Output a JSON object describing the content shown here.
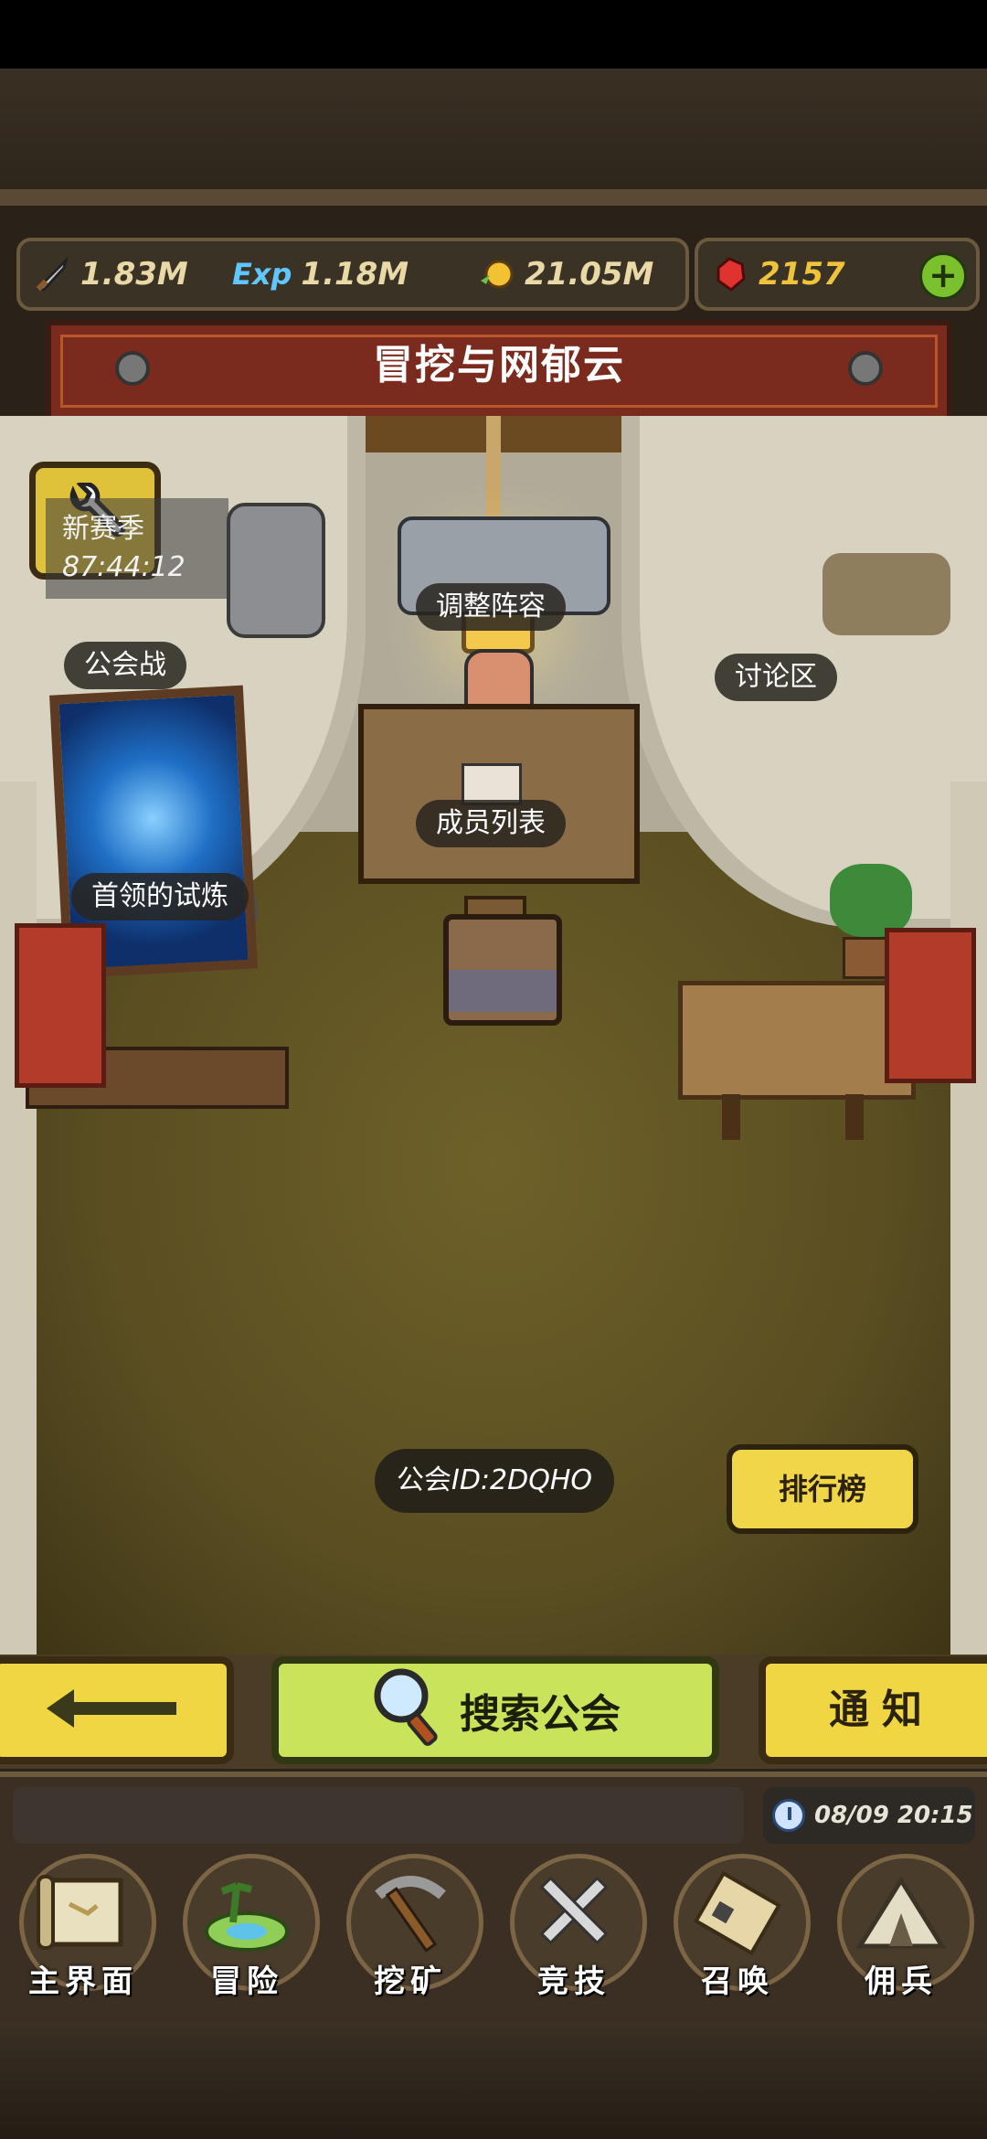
{
  "resources": {
    "attack": "1.83M",
    "exp_icon_label": "Exp",
    "exp": "1.18M",
    "gold": "21.05M",
    "gems": "2157"
  },
  "guild": {
    "title": "冒挖与网郁云",
    "season_label": "新赛季",
    "season_timer": "87:44:12",
    "guild_id_prefix": "公会",
    "guild_id_value": "ID:2DQHO"
  },
  "scene_labels": {
    "adjust_lineup": "调整阵容",
    "guild_war": "公会战",
    "discussion": "讨论区",
    "member_list": "成员列表",
    "boss_trial": "首领的试炼",
    "ranking": "排行榜"
  },
  "actions": {
    "search_guild": "搜索公会",
    "notify": "通知"
  },
  "status": {
    "datetime": "08/09 20:15"
  },
  "nav": [
    {
      "label": "主界面",
      "icon": "scroll-map-icon"
    },
    {
      "label": "冒险",
      "icon": "island-icon"
    },
    {
      "label": "挖矿",
      "icon": "pickaxe-icon"
    },
    {
      "label": "竞技",
      "icon": "crossed-swords-icon"
    },
    {
      "label": "召唤",
      "icon": "summon-scroll-icon"
    },
    {
      "label": "佣兵",
      "icon": "tent-icon"
    }
  ],
  "colors": {
    "banner": "#7b2a1e",
    "button_yellow": "#efd642",
    "button_green": "#c9e35a",
    "gem_text": "#f0c43a"
  }
}
